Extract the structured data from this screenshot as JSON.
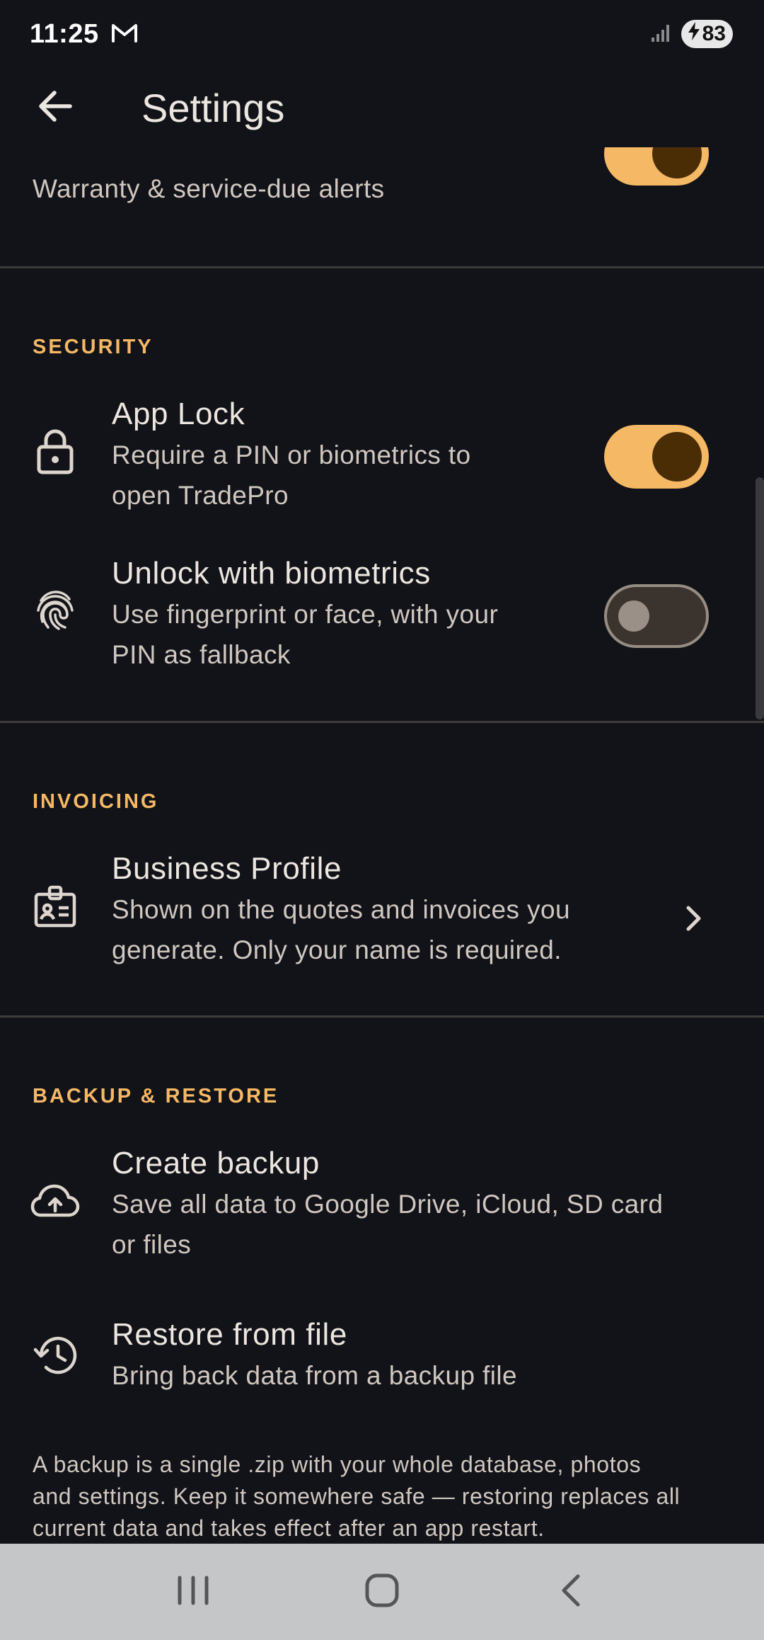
{
  "status_bar": {
    "time": "11:25",
    "notification_icon": "gmail-icon",
    "battery_level": "83"
  },
  "app_bar": {
    "title": "Settings",
    "back_icon": "arrow-left-icon"
  },
  "partial_row": {
    "subtitle": "Warranty & service-due alerts",
    "toggle_on": true
  },
  "security": {
    "header": "SECURITY",
    "app_lock": {
      "title": "App Lock",
      "subtitle_line1": "Require a PIN or biometrics to",
      "subtitle_line2": "open TradePro",
      "icon": "lock-icon",
      "toggle_on": true
    },
    "biometrics": {
      "title": "Unlock with biometrics",
      "subtitle_line1": "Use fingerprint or face, with your",
      "subtitle_line2": "PIN as fallback",
      "icon": "fingerprint-icon",
      "toggle_on": false
    }
  },
  "invoicing": {
    "header": "INVOICING",
    "business_profile": {
      "title": "Business Profile",
      "subtitle_line1": "Shown on the quotes and invoices you",
      "subtitle_line2": "generate. Only your name is required.",
      "icon": "badge-icon"
    }
  },
  "backup": {
    "header": "BACKUP & RESTORE",
    "create": {
      "title": "Create backup",
      "subtitle_line1": "Save all data to Google Drive, iCloud, SD card",
      "subtitle_line2": "or files",
      "icon": "cloud-upload-icon"
    },
    "restore": {
      "title": "Restore from file",
      "subtitle": "Bring back data from a backup file",
      "icon": "history-icon"
    },
    "note_line1": "A backup is a single .zip with your whole database, photos",
    "note_line2": "and settings. Keep it somewhere safe — restoring replaces all",
    "note_line3": "current data and takes effect after an app restart."
  },
  "colors": {
    "background": "#121318",
    "accent": "#f5b865",
    "text_primary": "#ece6e0",
    "text_secondary": "#cfc7c0"
  }
}
